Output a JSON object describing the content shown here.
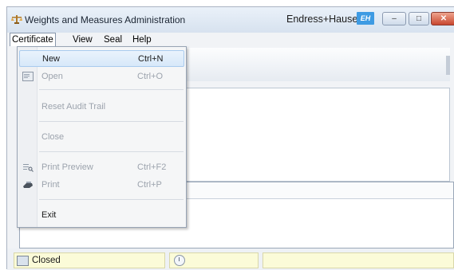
{
  "window": {
    "title": "Weights and Measures Administration",
    "brand": "Endress+Hauser",
    "brand_logo": "EH",
    "controls": {
      "minimize": "–",
      "maximize": "□",
      "close": "✕"
    }
  },
  "menubar": {
    "items": [
      "Certificate",
      "View",
      "Seal",
      "Help"
    ]
  },
  "certificate_menu": {
    "items": [
      {
        "label": "New",
        "shortcut": "Ctrl+N",
        "enabled": true,
        "icon": ""
      },
      {
        "label": "Open",
        "shortcut": "Ctrl+O",
        "enabled": false,
        "icon": "open-icon"
      },
      {
        "label": "Reset Audit Trail",
        "shortcut": "",
        "enabled": false,
        "icon": ""
      },
      {
        "label": "Close",
        "shortcut": "",
        "enabled": false,
        "icon": ""
      },
      {
        "label": "Print Preview",
        "shortcut": "Ctrl+F2",
        "enabled": false,
        "icon": "print-preview-icon"
      },
      {
        "label": "Print",
        "shortcut": "Ctrl+P",
        "enabled": false,
        "icon": "print-icon"
      },
      {
        "label": "Exit",
        "shortcut": "",
        "enabled": true,
        "icon": ""
      }
    ]
  },
  "statusbar": {
    "state": "Closed",
    "icons": [
      "document-icon",
      "clock-icon"
    ]
  },
  "colors": {
    "titlebar": "#d7e2ef",
    "status_cell": "#fbfbd8",
    "highlight": "#d7e8f9",
    "close_button": "#c8472f"
  }
}
